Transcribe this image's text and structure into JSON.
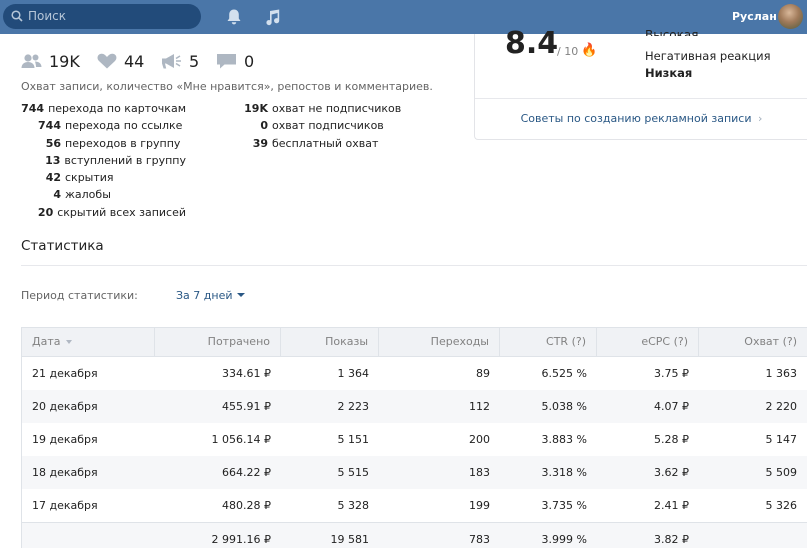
{
  "topbar": {
    "search_placeholder": "Поиск",
    "username": "Руслан"
  },
  "post_stats": {
    "reach": "19K",
    "likes": "44",
    "reposts": "5",
    "comments": "0",
    "description": "Охват записи, количество «Мне нравится», репостов и комментариев."
  },
  "metrics_left": [
    {
      "value": "744",
      "label": "перехода по карточкам"
    },
    {
      "value": "744",
      "label": "перехода по ссылке"
    },
    {
      "value": "56",
      "label": "переходов в группу"
    },
    {
      "value": "13",
      "label": "вступлений в группу"
    },
    {
      "value": "42",
      "label": "скрытия"
    },
    {
      "value": "4",
      "label": "жалобы"
    },
    {
      "value": "20",
      "label": "скрытий всех записей"
    }
  ],
  "metrics_right": [
    {
      "value": "19K",
      "label": "охват не подписчиков"
    },
    {
      "value": "0",
      "label": "охват подписчиков"
    },
    {
      "value": "39",
      "label": "бесплатный охват"
    }
  ],
  "relevance": {
    "score": "8.4",
    "max": "/ 10",
    "top_cut": "Высокая",
    "negative_label": "Негативная реакция",
    "negative_value": "Низкая",
    "tips_link": "Советы по созданию рекламной записи"
  },
  "statistics": {
    "title": "Статистика",
    "period_label": "Период статистики:",
    "period_value": "За 7 дней"
  },
  "table": {
    "headers": [
      "Дата",
      "Потрачено",
      "Показы",
      "Переходы",
      "CTR (?)",
      "eCPC (?)",
      "Охват (?)"
    ],
    "rows": [
      [
        "21 декабря",
        "334.61 ₽",
        "1 364",
        "89",
        "6.525 %",
        "3.75 ₽",
        "1 363"
      ],
      [
        "20 декабря",
        "455.91 ₽",
        "2 223",
        "112",
        "5.038 %",
        "4.07 ₽",
        "2 220"
      ],
      [
        "19 декабря",
        "1 056.14 ₽",
        "5 151",
        "200",
        "3.883 %",
        "5.28 ₽",
        "5 147"
      ],
      [
        "18 декабря",
        "664.22 ₽",
        "5 515",
        "183",
        "3.318 %",
        "3.62 ₽",
        "5 509"
      ],
      [
        "17 декабря",
        "480.28 ₽",
        "5 328",
        "199",
        "3.735 %",
        "2.41 ₽",
        "5 326"
      ]
    ],
    "total": [
      "",
      "2 991.16 ₽",
      "19 581",
      "783",
      "3.999 %",
      "3.82 ₽",
      ""
    ]
  }
}
